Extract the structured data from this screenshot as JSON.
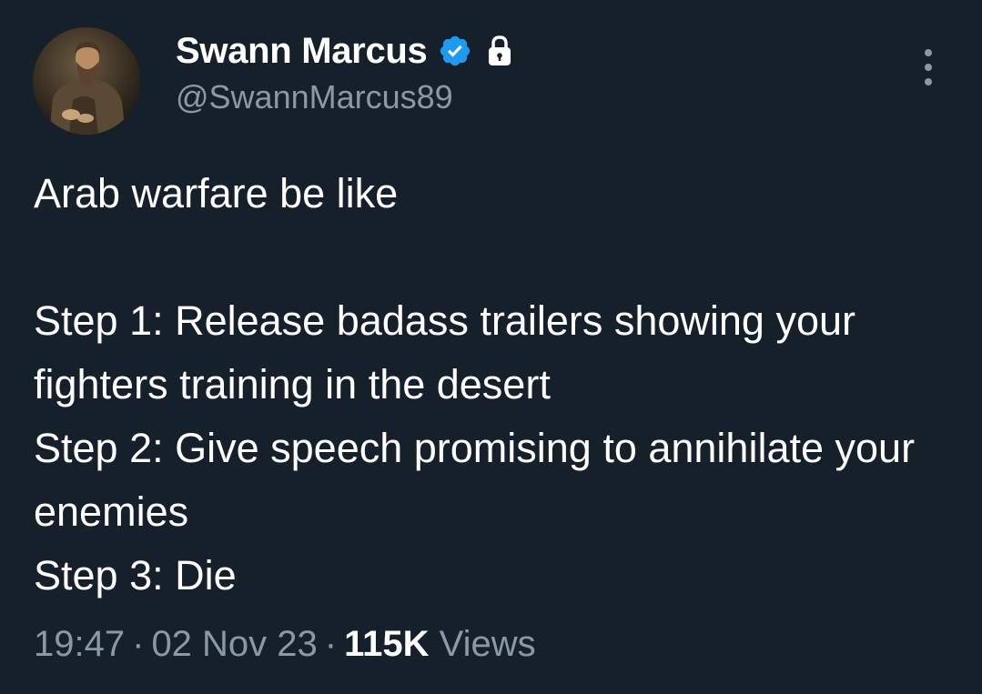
{
  "author": {
    "display_name": "Swann Marcus",
    "handle": "@SwannMarcus89",
    "verified_badge_icon": "verified-badge-icon",
    "protected_icon": "lock-icon",
    "avatar": "avatar"
  },
  "tweet": {
    "text": "Arab warfare be like\n\nStep 1: Release badass trailers showing your fighters training in the desert\nStep 2: Give speech promising to annihilate your enemies\nStep 3: Die"
  },
  "meta": {
    "time": "19:47",
    "separator": "·",
    "date": "02 Nov 23",
    "views_count": "115K",
    "views_label": "Views"
  },
  "menu": {
    "icon": "more-options-icon"
  },
  "colors": {
    "background": "#15202b",
    "primary_text": "#ffffff",
    "secondary_text": "#8b98a5",
    "verified_blue": "#1d9bf0"
  }
}
